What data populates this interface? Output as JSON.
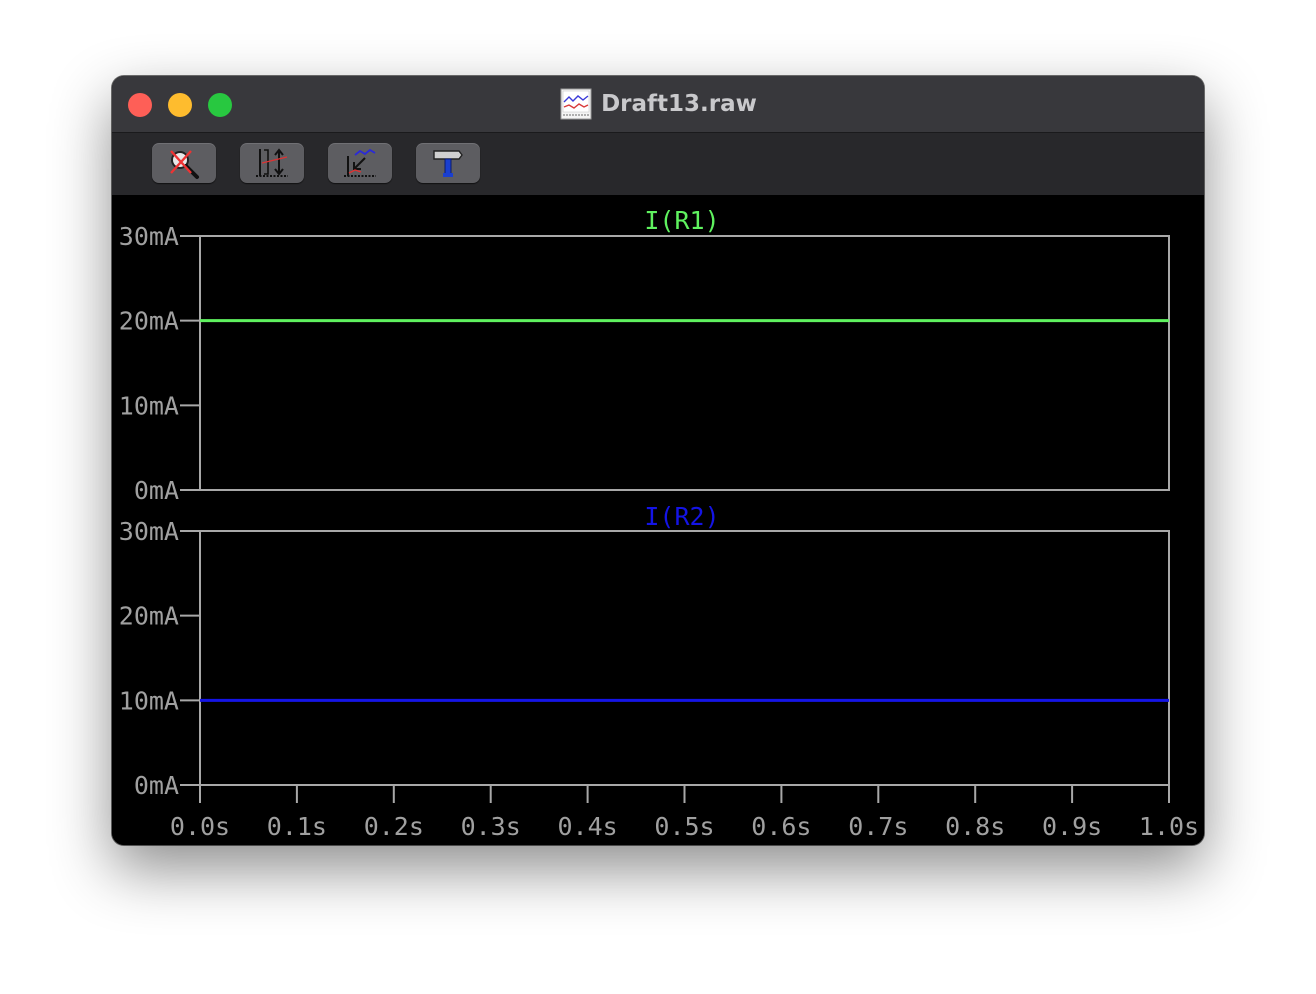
{
  "window": {
    "title": "Draft13.raw",
    "title_icon": "waveform-doc-icon",
    "toolbar": [
      {
        "name": "autorange-zoom-button",
        "icon": "magnifier-cross-icon"
      },
      {
        "name": "autorange-y-button",
        "icon": "vertical-range-icon"
      },
      {
        "name": "zoom-back-button",
        "icon": "zoom-back-icon"
      },
      {
        "name": "probe-tool-button",
        "icon": "hammer-icon"
      }
    ]
  },
  "chart_data": [
    {
      "type": "line",
      "title": "I(R1)",
      "color": "#5ff25f",
      "x": [
        0.0,
        1.0
      ],
      "series": [
        {
          "name": "I(R1)",
          "values": [
            20,
            20
          ]
        }
      ],
      "ylim": [
        0,
        30
      ],
      "yticks": [
        "0mA",
        "10mA",
        "20mA",
        "30mA"
      ],
      "xlim": [
        0.0,
        1.0
      ],
      "xticks": []
    },
    {
      "type": "line",
      "title": "I(R2)",
      "color": "#1414e6",
      "x": [
        0.0,
        1.0
      ],
      "series": [
        {
          "name": "I(R2)",
          "values": [
            10,
            10
          ]
        }
      ],
      "ylim": [
        0,
        30
      ],
      "yticks": [
        "0mA",
        "10mA",
        "20mA",
        "30mA"
      ],
      "xlim": [
        0.0,
        1.0
      ],
      "xticks": [
        "0.0s",
        "0.1s",
        "0.2s",
        "0.3s",
        "0.4s",
        "0.5s",
        "0.6s",
        "0.7s",
        "0.8s",
        "0.9s",
        "1.0s"
      ]
    }
  ]
}
